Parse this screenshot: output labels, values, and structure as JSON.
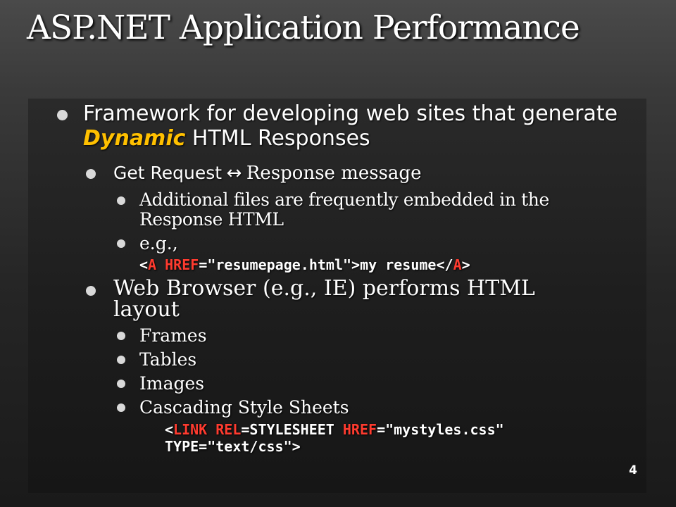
{
  "slide": {
    "title": "ASP.NET Application Performance",
    "page_number": "4"
  },
  "bullets": {
    "framework": {
      "prefix": "Framework for developing web sites that generate ",
      "emphasis": "Dynamic",
      "suffix": " HTML Responses"
    },
    "get_request": {
      "part1": "Get Request",
      "arrow": "↔",
      "part2": "Response message"
    },
    "additional_files": "Additional files are frequently embedded in the Response HTML",
    "eg": "e.g.,",
    "code_anchor": {
      "open_bracket": "<",
      "tag": "A",
      "attr": "HREF",
      "assign": "=\"resumepage.html\">",
      "text": "my resume",
      "close_open": "</",
      "close_tag": "A",
      "close_end": ">"
    },
    "web_browser": "Web Browser (e.g., IE) performs HTML layout",
    "layout_items": [
      "Frames",
      "Tables",
      "Images",
      "Cascading Style Sheets"
    ],
    "code_link": {
      "open_bracket": "<",
      "tag": "LINK",
      "attr1": "REL",
      "val1": "=STYLESHEET ",
      "attr2": "HREF",
      "val2": "=\"mystyles.css\" ",
      "attr3": "TYPE",
      "val3": "=\"text/css\">"
    }
  },
  "colors": {
    "emphasis": "#ffc000",
    "code_keyword": "#ff3b2f",
    "text": "#ffffff",
    "bullet": "#d9d9d9"
  }
}
